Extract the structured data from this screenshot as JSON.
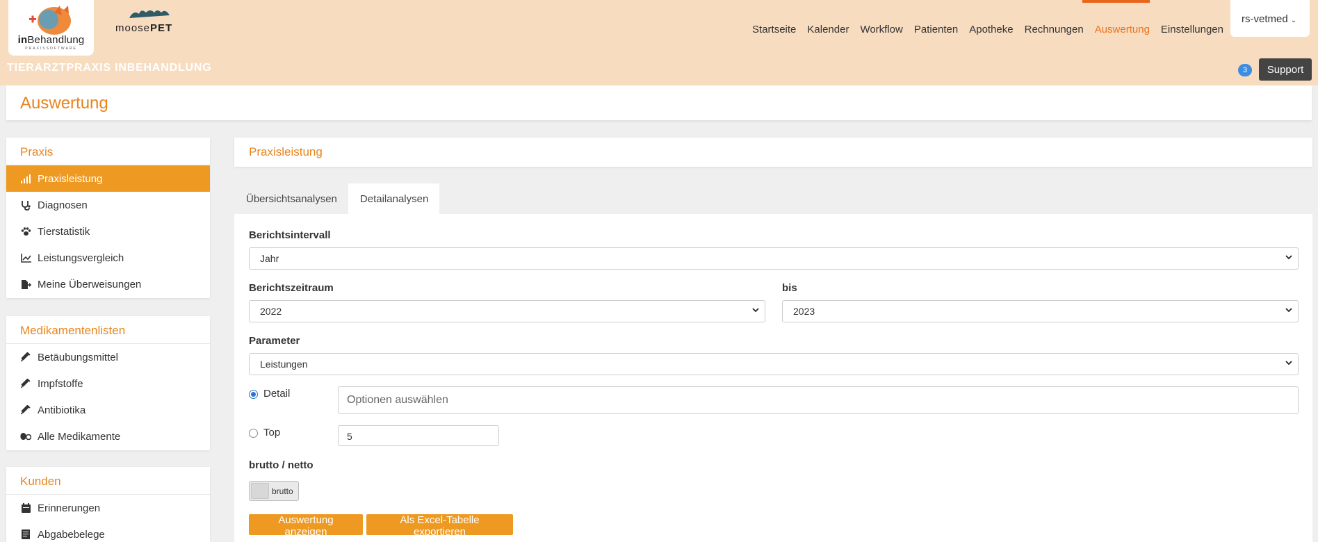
{
  "header": {
    "brand": {
      "logo_main_bold": "in",
      "logo_main": "Behandlung",
      "logo_sub": "PRAXISSOFTWARE",
      "partner_text_a": "moose",
      "partner_text_b": "PET"
    },
    "nav": [
      {
        "label": "Startseite",
        "active": false
      },
      {
        "label": "Kalender",
        "active": false
      },
      {
        "label": "Workflow",
        "active": false
      },
      {
        "label": "Patienten",
        "active": false
      },
      {
        "label": "Apotheke",
        "active": false
      },
      {
        "label": "Rechnungen",
        "active": false
      },
      {
        "label": "Auswertung",
        "active": true
      },
      {
        "label": "Einstellungen",
        "active": false
      }
    ],
    "user": "rs-vetmed",
    "practice_name": "TIERARZTPRAXIS INBEHANDLUNG",
    "badge_count": "3",
    "support_label": "Support"
  },
  "page_title": "Auswertung",
  "sidebar": {
    "praxis": {
      "title": "Praxis",
      "items": [
        {
          "label": "Praxisleistung",
          "icon": "bar-signal-icon",
          "active": true
        },
        {
          "label": "Diagnosen",
          "icon": "stethoscope-icon",
          "active": false
        },
        {
          "label": "Tierstatistik",
          "icon": "paw-icon",
          "active": false
        },
        {
          "label": "Leistungsvergleich",
          "icon": "line-chart-icon",
          "active": false
        },
        {
          "label": "Meine Überweisungen",
          "icon": "file-export-icon",
          "active": false
        }
      ]
    },
    "medikamente": {
      "title": "Medikamentenlisten",
      "items": [
        {
          "label": "Betäubungsmittel",
          "icon": "syringe-icon"
        },
        {
          "label": "Impfstoffe",
          "icon": "syringe-icon"
        },
        {
          "label": "Antibiotika",
          "icon": "syringe-icon"
        },
        {
          "label": "Alle Medikamente",
          "icon": "pills-icon"
        }
      ]
    },
    "kunden": {
      "title": "Kunden",
      "items": [
        {
          "label": "Erinnerungen",
          "icon": "calendar-icon"
        },
        {
          "label": "Abgabebelege",
          "icon": "receipt-icon"
        }
      ]
    }
  },
  "main": {
    "section_title": "Praxisleistung",
    "tabs": [
      {
        "label": "Übersichtsanalysen",
        "active": false
      },
      {
        "label": "Detailanalysen",
        "active": true
      }
    ],
    "form": {
      "interval_label": "Berichtsintervall",
      "interval_value": "Jahr",
      "period_label": "Berichtszeitraum",
      "period_from": "2022",
      "period_to_label": "bis",
      "period_to": "2023",
      "parameter_label": "Parameter",
      "parameter_value": "Leistungen",
      "detail_label": "Detail",
      "detail_placeholder": "Optionen auswählen",
      "top_label": "Top",
      "top_value": "5",
      "selected_mode": "Detail",
      "brutto_netto_label": "brutto / netto",
      "toggle_label": "brutto",
      "show_button": "Auswertung anzeigen",
      "export_button": "Als Excel-Tabelle exportieren"
    }
  },
  "colors": {
    "accent": "#ee9a22",
    "header_bg": "#f7dcc0",
    "title_orange": "#e8841c",
    "nav_active": "#ea7320"
  }
}
